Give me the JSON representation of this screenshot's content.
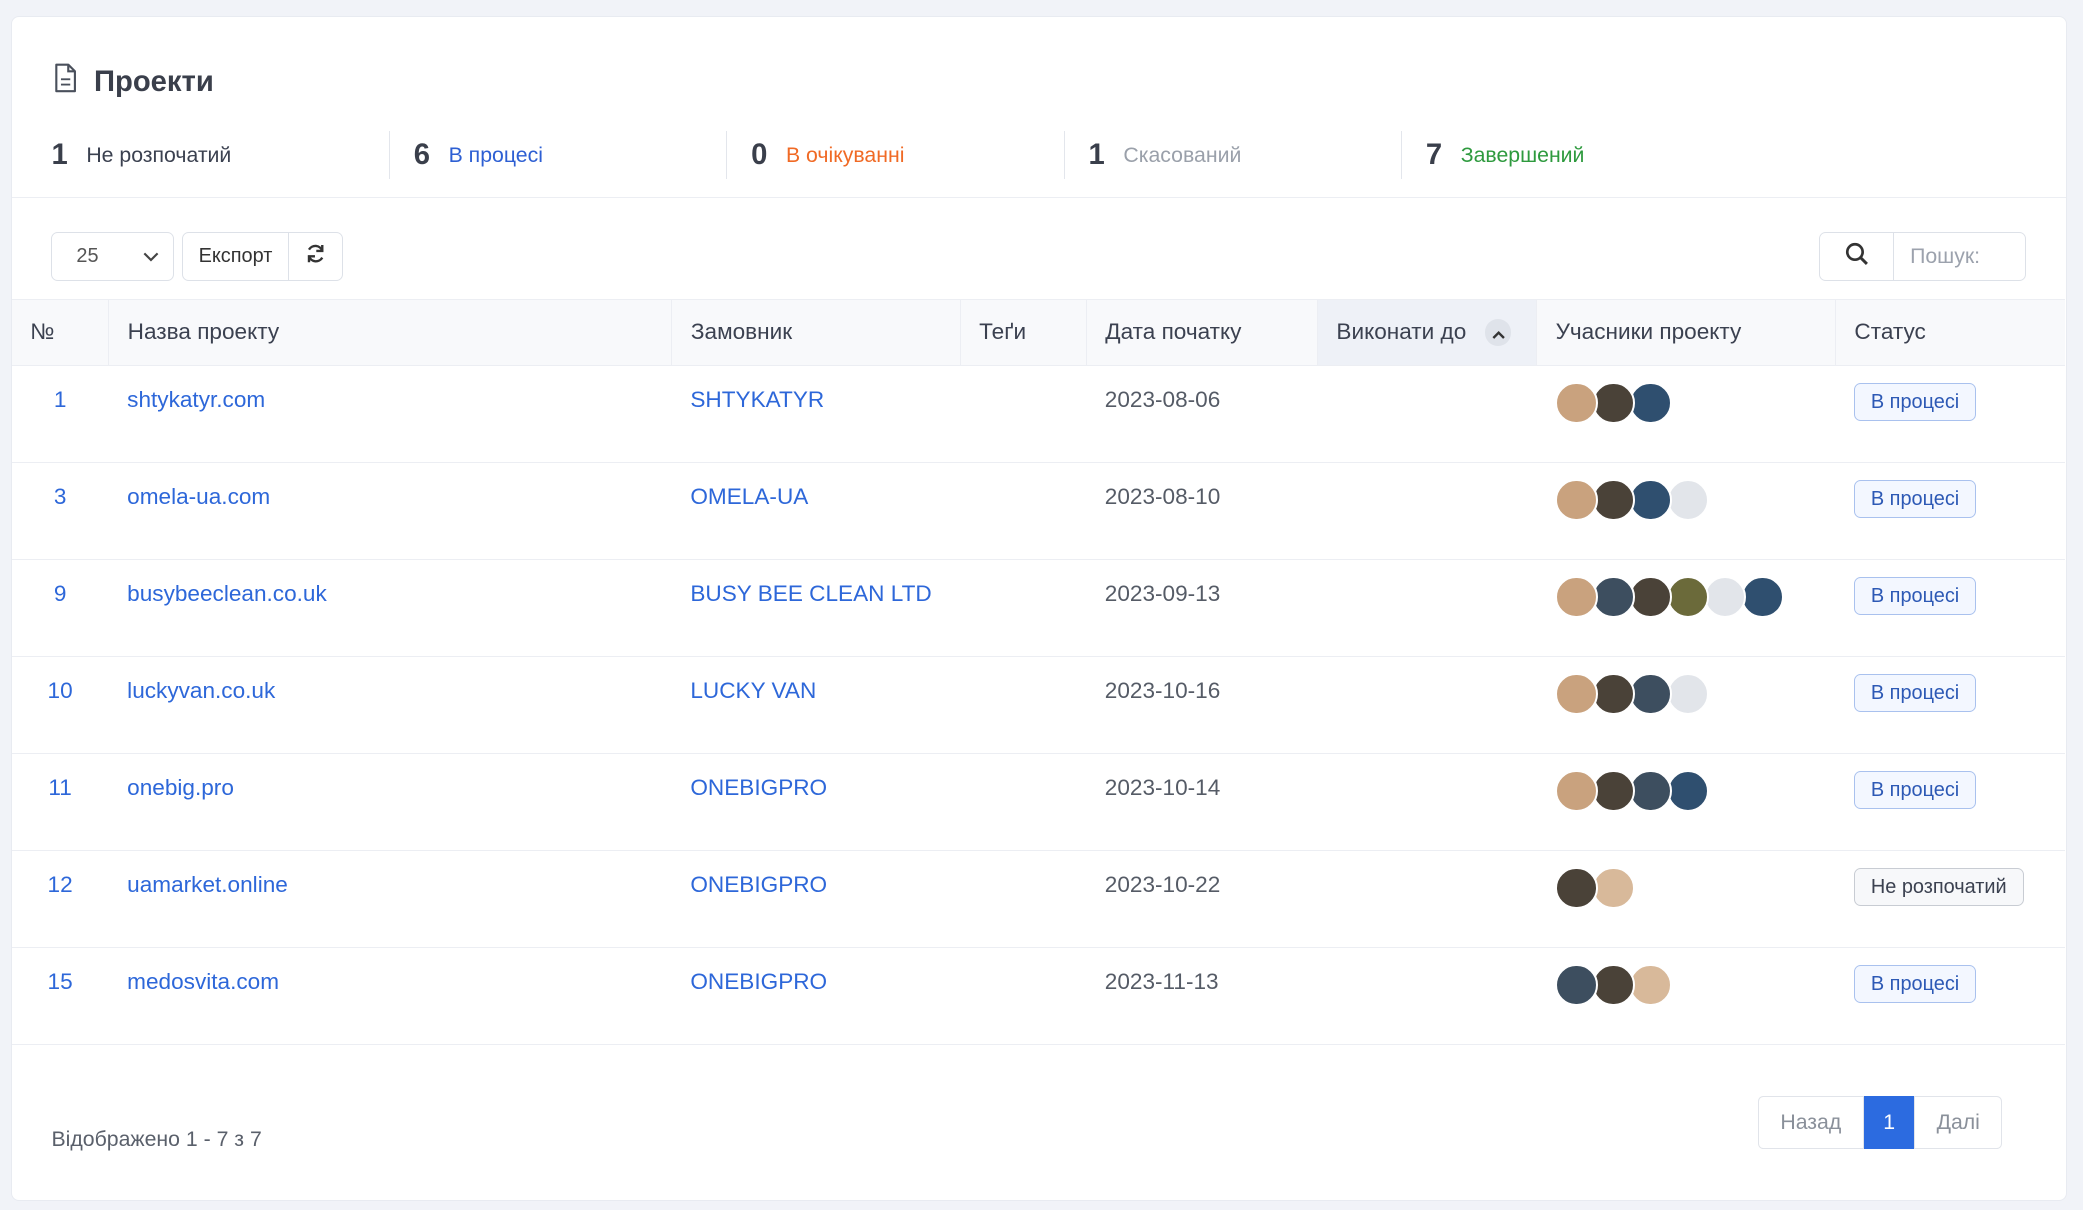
{
  "title": "Проекти",
  "stats": [
    {
      "count": "1",
      "label": "Не розпочатий",
      "color": "#3b4150"
    },
    {
      "count": "6",
      "label": "В процесі",
      "color": "#2d5fd3"
    },
    {
      "count": "0",
      "label": "В очікуванні",
      "color": "#f06a25"
    },
    {
      "count": "1",
      "label": "Скасований",
      "color": "#9aa0aa"
    },
    {
      "count": "7",
      "label": "Завершений",
      "color": "#2e9a3e"
    }
  ],
  "toolbar": {
    "page_size": "25",
    "export_label": "Експорт"
  },
  "search": {
    "placeholder": "Пошук:"
  },
  "columns": [
    "№",
    "Назва проекту",
    "Замовник",
    "Теґи",
    "Дата початку",
    "Виконати до",
    "Учасники проекту",
    "Статус"
  ],
  "rows": [
    {
      "num": "1",
      "name": "shtykatyr.com",
      "client": "SHTYKATYR",
      "tags": "",
      "start": "2023-08-06",
      "due": "",
      "members": [
        "#c9a27e",
        "#4a4238",
        "#2f4f6f"
      ],
      "status": "В процесі",
      "status_type": "progress"
    },
    {
      "num": "3",
      "name": "omela-ua.com",
      "client": "OMELA-UA",
      "tags": "",
      "start": "2023-08-10",
      "due": "",
      "members": [
        "#c9a27e",
        "#4a4238",
        "#2f4f6f",
        "#e2e5ea"
      ],
      "status": "В процесі",
      "status_type": "progress"
    },
    {
      "num": "9",
      "name": "busybeeclean.co.uk",
      "client": "BUSY BEE CLEAN LTD",
      "tags": "",
      "start": "2023-09-13",
      "due": "",
      "members": [
        "#c9a27e",
        "#3d4e5f",
        "#4a4238",
        "#6b6a3a",
        "#e2e5ea",
        "#2f4f6f"
      ],
      "status": "В процесі",
      "status_type": "progress"
    },
    {
      "num": "10",
      "name": "luckyvan.co.uk",
      "client": "LUCKY VAN",
      "tags": "",
      "start": "2023-10-16",
      "due": "",
      "members": [
        "#c9a27e",
        "#4a4238",
        "#3d4e5f",
        "#e2e5ea"
      ],
      "status": "В процесі",
      "status_type": "progress"
    },
    {
      "num": "11",
      "name": "onebig.pro",
      "client": "ONEBIGPRO",
      "tags": "",
      "start": "2023-10-14",
      "due": "",
      "members": [
        "#c9a27e",
        "#4a4238",
        "#3d4e5f",
        "#2f4f6f"
      ],
      "status": "В процесі",
      "status_type": "progress"
    },
    {
      "num": "12",
      "name": "uamarket.online",
      "client": "ONEBIGPRO",
      "tags": "",
      "start": "2023-10-22",
      "due": "",
      "members": [
        "#4a4238",
        "#d8b99a"
      ],
      "status": "Не розпочатий",
      "status_type": "not-started"
    },
    {
      "num": "15",
      "name": "medosvita.com",
      "client": "ONEBIGPRO",
      "tags": "",
      "start": "2023-11-13",
      "due": "",
      "members": [
        "#3d4e5f",
        "#4a4238",
        "#d8b99a"
      ],
      "status": "В процесі",
      "status_type": "progress"
    }
  ],
  "footer": {
    "info": "Відображено 1 - 7 з 7",
    "prev": "Назад",
    "current_page": "1",
    "next": "Далі"
  }
}
